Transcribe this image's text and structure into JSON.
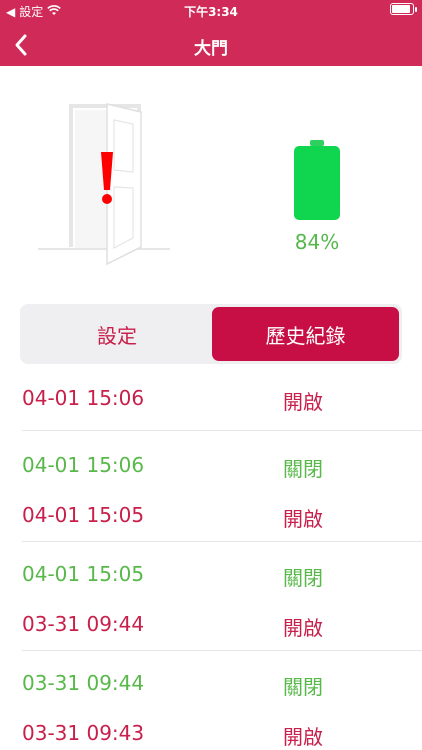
{
  "status_bar": {
    "carrier": "設定",
    "time": "下午3:34"
  },
  "nav": {
    "title": "大門"
  },
  "device": {
    "battery_percent": 84,
    "battery_label": "84%"
  },
  "tabs": [
    {
      "label": "設定",
      "selected": false
    },
    {
      "label": "歷史紀錄",
      "selected": true
    }
  ],
  "history": [
    [
      {
        "time": "04-01 15:06",
        "state": "開啟",
        "color": "red"
      }
    ],
    [
      {
        "time": "04-01 15:06",
        "state": "關閉",
        "color": "green"
      },
      {
        "time": "04-01 15:05",
        "state": "開啟",
        "color": "red"
      }
    ],
    [
      {
        "time": "04-01 15:05",
        "state": "關閉",
        "color": "green"
      },
      {
        "time": "03-31 09:44",
        "state": "開啟",
        "color": "red"
      }
    ],
    [
      {
        "time": "03-31 09:44",
        "state": "關閉",
        "color": "green"
      },
      {
        "time": "03-31 09:43",
        "state": "開啟",
        "color": "red"
      }
    ]
  ],
  "colors": {
    "header": "#d02b58",
    "accent": "#c70f45",
    "open": "#c8204b",
    "closed": "#58b84a"
  }
}
